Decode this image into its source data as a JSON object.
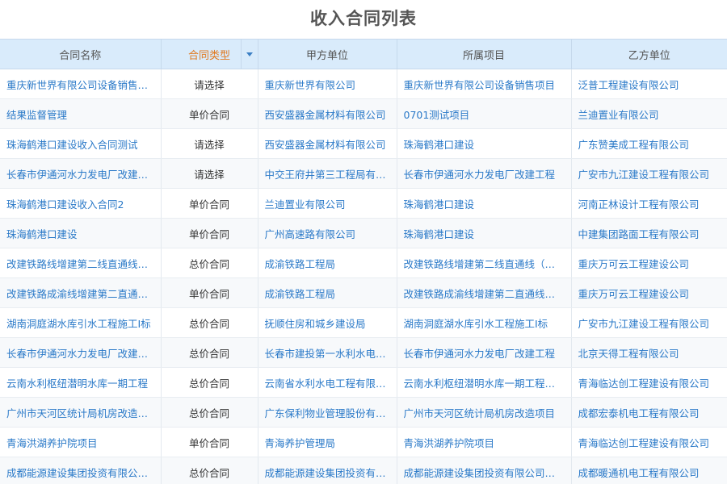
{
  "title": "收入合同列表",
  "headers": [
    "合同名称",
    "合同类型",
    "甲方单位",
    "所属项目",
    "乙方单位"
  ],
  "rows": [
    {
      "name": "重庆新世界有限公司设备销售项目",
      "type": "请选择",
      "partyA": "重庆新世界有限公司",
      "project": "重庆新世界有限公司设备销售项目",
      "partyB": "泛普工程建设有限公司"
    },
    {
      "name": "结果监督管理",
      "type": "单价合同",
      "partyA": "西安盛器金属材料有限公司",
      "project": "0701测试项目",
      "partyB": "兰迪置业有限公司"
    },
    {
      "name": "珠海鹤港口建设收入合同测试",
      "type": "请选择",
      "partyA": "西安盛器金属材料有限公司",
      "project": "珠海鹤港口建设",
      "partyB": "广东赞美成工程有限公司"
    },
    {
      "name": "长春市伊通河水力发电厂改建工程",
      "type": "请选择",
      "partyA": "中交王府井第三工程局有限公司",
      "project": "长春市伊通河水力发电厂改建工程",
      "partyB": "广安市九江建设工程有限公司"
    },
    {
      "name": "珠海鹤港口建设收入合同2",
      "type": "单价合同",
      "partyA": "兰迪置业有限公司",
      "project": "珠海鹤港口建设",
      "partyB": "河南正林设计工程有限公司"
    },
    {
      "name": "珠海鹤港口建设",
      "type": "单价合同",
      "partyA": "广州高速路有限公司",
      "project": "珠海鹤港口建设",
      "partyB": "中建集团路面工程有限公司"
    },
    {
      "name": "改建铁路线增建第二线直通线工程",
      "type": "总价合同",
      "partyA": "成渝铁路工程局",
      "project": "改建铁路线增建第二线直通线（成都至重庆）",
      "partyB": "重庆万可云工程建设公司"
    },
    {
      "name": "改建铁路成渝线增建第二直通线工程",
      "type": "单价合同",
      "partyA": "成渝铁路工程局",
      "project": "改建铁路成渝线增建第二直通线工程",
      "partyB": "重庆万可云工程建设公司"
    },
    {
      "name": "湖南洞庭湖水库引水工程施工I标",
      "type": "总价合同",
      "partyA": "抚顺住房和城乡建设局",
      "project": "湖南洞庭湖水库引水工程施工I标",
      "partyB": "广安市九江建设工程有限公司"
    },
    {
      "name": "长春市伊通河水力发电厂改建工程",
      "type": "总价合同",
      "partyA": "长春市建投第一水利水电工程局",
      "project": "长春市伊通河水力发电厂改建工程",
      "partyB": "北京天得工程有限公司"
    },
    {
      "name": "云南水利枢纽潜明水库一期工程",
      "type": "总价合同",
      "partyA": "云南省水利水电工程有限公司",
      "project": "云南水利枢纽潜明水库一期工程施工",
      "partyB": "青海临达创工程建设有限公司"
    },
    {
      "name": "广州市天河区统计局机房改造项目",
      "type": "总价合同",
      "partyA": "广东保利物业管理股份有限公司",
      "project": "广州市天河区统计局机房改造项目",
      "partyB": "成都宏泰机电工程有限公司"
    },
    {
      "name": "青海洪湖养护院项目",
      "type": "单价合同",
      "partyA": "青海养护管理局",
      "project": "青海洪湖养护院项目",
      "partyB": "青海临达创工程建设有限公司"
    },
    {
      "name": "成都能源建设集团投资有限公司项目",
      "type": "总价合同",
      "partyA": "成都能源建设集团投资有限公司",
      "project": "成都能源建设集团投资有限公司项目",
      "partyB": "成都暖通机电工程有限公司"
    }
  ]
}
